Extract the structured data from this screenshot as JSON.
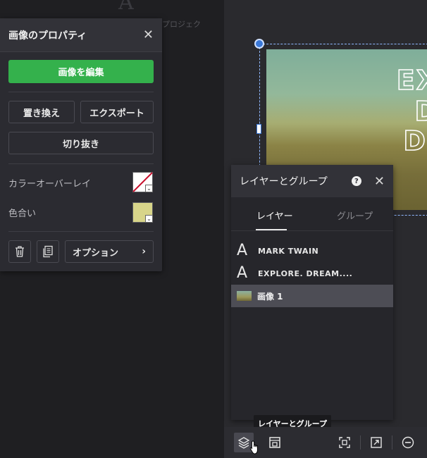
{
  "background": {
    "top_label": "プロジェク"
  },
  "canvas": {
    "image_text_lines": [
      "EX",
      "D",
      "DI"
    ]
  },
  "properties_panel": {
    "title": "画像のプロパティ",
    "edit_image_label": "画像を編集",
    "replace_label": "置き換え",
    "export_label": "エクスポート",
    "crop_label": "切り抜き",
    "color_overlay_label": "カラーオーバーレイ",
    "tint_label": "色合い",
    "tint_color": "#d8d58a",
    "options_label": "オプション",
    "accent_color": "#34b14c"
  },
  "layers_panel": {
    "title": "レイヤーとグループ",
    "tabs": [
      {
        "label": "レイヤー",
        "active": true
      },
      {
        "label": "グループ",
        "active": false
      }
    ],
    "layers": [
      {
        "icon": "text-layer-icon",
        "glyph": "A",
        "name": "MARK TWAIN",
        "selected": false
      },
      {
        "icon": "text-layer-icon",
        "glyph": "A",
        "name": "EXPLORE. DREAM....",
        "selected": false
      },
      {
        "icon": "image-thumbnail",
        "glyph": "",
        "name": "画像 1",
        "selected": true
      }
    ]
  },
  "tooltip": {
    "text": "レイヤーとグループ"
  },
  "bottom_toolbar": {
    "items": [
      "layers-icon",
      "layout-icon",
      "fit-screen-icon",
      "open-external-icon",
      "zoom-out-icon"
    ]
  }
}
